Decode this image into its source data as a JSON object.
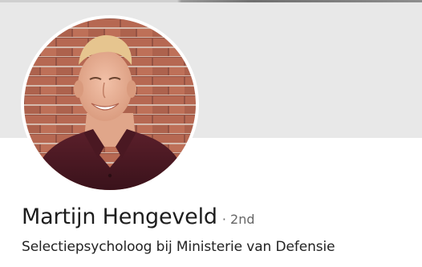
{
  "profile": {
    "name": "Martijn Hengeveld",
    "degree_separator": "·",
    "degree": "2nd",
    "headline": "Selectiepsycholoog bij Ministerie van Defensie"
  },
  "icons": {
    "avatar": "profile-photo"
  },
  "colors": {
    "cover_background": "#e8e8e8",
    "page_background": "#ffffff",
    "name_text": "#1d1d1d",
    "degree_text": "#666666",
    "headline_text": "#222222"
  }
}
